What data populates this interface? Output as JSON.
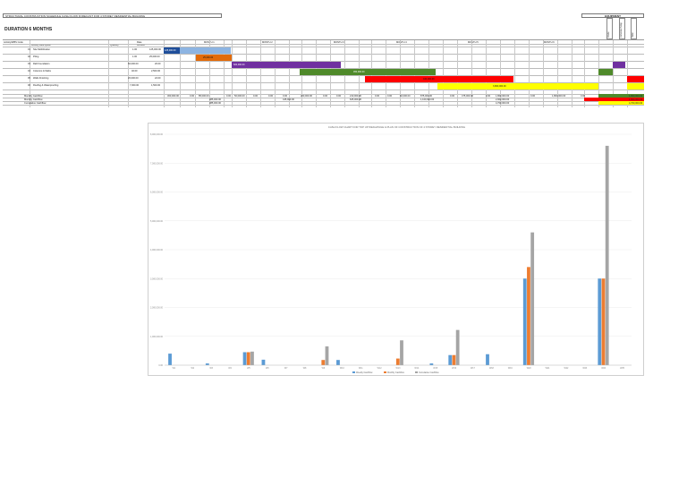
{
  "header": {
    "project_title": "STRUCTURAL CONSTRUCTION SCHEDULE CASH FLOW FORECAST FOR 4 STOREY RESIDENTIAL BUILDING",
    "duration_title": "DURATION 6 MONTHS",
    "equipment_label": "EQUIPMENT",
    "equipment_columns": [
      "Crane",
      "Concrete Pump",
      "Hoist",
      "Other"
    ]
  },
  "table": {
    "col_headers": [
      "Activity/WBS Code",
      "Activity Description",
      "Quantity",
      "Rate",
      "Amount"
    ],
    "months": [
      "MONTH 1",
      "MONTH 2",
      "MONTH 3",
      "MONTH 4",
      "MONTH 5",
      "MONTH 6"
    ],
    "weeks": [
      "W1",
      "W2",
      "W3",
      "W4"
    ],
    "activities": [
      {
        "code": "01",
        "name": "Site Mobilization",
        "qty": "1.00",
        "rate": "125,000.00",
        "bar_label": "125,000.00"
      },
      {
        "code": "02",
        "name": "Piling",
        "qty": "1.00",
        "rate": "25,000.00",
        "bar_label": "25,000.00"
      },
      {
        "code": "03",
        "name": "Raft Foundation",
        "qty": "60,000.00",
        "rate": "20.00",
        "bar_label": "600,000.00"
      },
      {
        "code": "04",
        "name": "Columns & Slabs",
        "qty": "40.00",
        "rate": "2,500.00",
        "bar_label": "450,000.00"
      },
      {
        "code": "05",
        "name": "Walls Finishing",
        "qty": "20,000.00",
        "rate": "22.00",
        "bar_label": "440,000.00"
      },
      {
        "code": "06",
        "name": "Roofing & Waterproofing",
        "qty": "7,000.00",
        "rate": "1,500.00",
        "bar_label": "3,800,000.00"
      }
    ],
    "summary_rows": [
      "Monthly Cashflow",
      "Monthly Cashflow",
      "Cumulative Cashflow"
    ],
    "summary_values": [
      "300,000.00",
      "0.00",
      "85,000.00",
      "0.00",
      "50,000.00",
      "0.00",
      "0.00",
      "0.00",
      "200,000.00",
      "0.00",
      "0.00",
      "210,000.00",
      "0.00",
      "0.00",
      "60,000.00",
      "875,000.00",
      "0.00",
      "475,000.00",
      "0.00",
      "1,800,000.00",
      "0.00",
      "1,800,000.00",
      "0.00"
    ],
    "cumulative_values": [
      "385,000.00",
      "385,000.00",
      "445,000.00",
      "625,000.00",
      "1,100,000.00",
      "2,900,000.00",
      "4,700,000.00"
    ],
    "totals": [
      "1,800,000.00",
      "1,800,000.00",
      "4,700,000.00"
    ]
  },
  "colors": {
    "blue": "#8db4e2",
    "orange": "#e26b0a",
    "purple": "#7030a0",
    "green": "#4f8a2a",
    "red": "#ff0000",
    "yellow": "#ffff00",
    "series1": "#5b9bd5",
    "series2": "#ed7d31",
    "series3": "#a5a5a5"
  },
  "chart_data": {
    "type": "bar",
    "title": "CASH FLOW CHART FOR TOP UP WEIGHTAGE & PLAN OF CONSTRUCTION OF 4 STOREY RESIDENTIAL BUILDING",
    "ylim": [
      0,
      8000000
    ],
    "y_ticks": [
      "0.00",
      "1,000,000.00",
      "2,000,000.00",
      "3,000,000.00",
      "4,000,000.00",
      "5,000,000.00",
      "6,000,000.00",
      "7,000,000.00",
      "8,000,000.00"
    ],
    "categories": [
      "W1",
      "W2",
      "W3",
      "W4",
      "W5",
      "W6",
      "W7",
      "W8",
      "W9",
      "W10",
      "W11",
      "W12",
      "W13",
      "W14",
      "W15",
      "W16",
      "W17",
      "W18",
      "W19",
      "W20",
      "W21",
      "W22",
      "W23",
      "W24",
      "W25"
    ],
    "series": [
      {
        "name": "Weekly Cashflow",
        "values": [
          400000,
          0,
          60000,
          0,
          450000,
          190000,
          0,
          0,
          0,
          180000,
          0,
          0,
          0,
          0,
          60000,
          350000,
          0,
          380000,
          0,
          3000000,
          0,
          0,
          0,
          3000000,
          0
        ]
      },
      {
        "name": "Monthly Cashflow",
        "values": [
          0,
          0,
          0,
          0,
          450000,
          0,
          0,
          0,
          180000,
          0,
          0,
          0,
          230000,
          0,
          0,
          350000,
          0,
          0,
          0,
          3400000,
          0,
          0,
          0,
          3000000,
          0
        ]
      },
      {
        "name": "Cumulative Cashflow",
        "values": [
          0,
          0,
          0,
          0,
          470000,
          0,
          0,
          0,
          650000,
          0,
          0,
          0,
          860000,
          0,
          0,
          1220000,
          0,
          0,
          0,
          4600000,
          0,
          0,
          0,
          7600000,
          0
        ]
      }
    ]
  }
}
